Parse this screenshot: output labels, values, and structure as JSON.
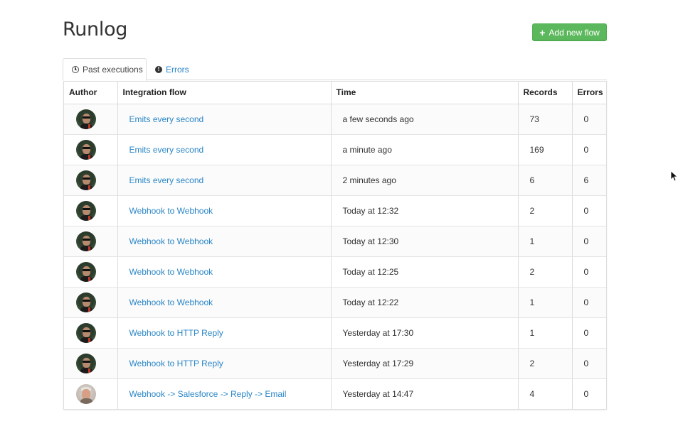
{
  "page": {
    "title": "Runlog",
    "add_button_label": "Add new flow",
    "add_button_icon": "plus-icon",
    "colors": {
      "link": "#2a86c6",
      "primary_button": "#5cb85c"
    }
  },
  "tabs": [
    {
      "label": "Past executions",
      "icon": "clock-icon",
      "active": true
    },
    {
      "label": "Errors",
      "icon": "alert-icon",
      "active": false
    }
  ],
  "table": {
    "headers": {
      "author": "Author",
      "flow": "Integration flow",
      "time": "Time",
      "records": "Records",
      "errors": "Errors"
    },
    "rows": [
      {
        "flow": "Emits every second",
        "time": "a few seconds ago",
        "records": "73",
        "errors": "0",
        "avatar": "avatar-sunglasses"
      },
      {
        "flow": "Emits every second",
        "time": "a minute ago",
        "records": "169",
        "errors": "0",
        "avatar": "avatar-sunglasses"
      },
      {
        "flow": "Emits every second",
        "time": "2 minutes ago",
        "records": "6",
        "errors": "6",
        "avatar": "avatar-sunglasses"
      },
      {
        "flow": "Webhook to Webhook",
        "time": "Today at 12:32",
        "records": "2",
        "errors": "0",
        "avatar": "avatar-sunglasses"
      },
      {
        "flow": "Webhook to Webhook",
        "time": "Today at 12:30",
        "records": "1",
        "errors": "0",
        "avatar": "avatar-sunglasses"
      },
      {
        "flow": "Webhook to Webhook",
        "time": "Today at 12:25",
        "records": "2",
        "errors": "0",
        "avatar": "avatar-sunglasses"
      },
      {
        "flow": "Webhook to Webhook",
        "time": "Today at 12:22",
        "records": "1",
        "errors": "0",
        "avatar": "avatar-sunglasses"
      },
      {
        "flow": "Webhook to HTTP Reply",
        "time": "Yesterday at 17:30",
        "records": "1",
        "errors": "0",
        "avatar": "avatar-sunglasses"
      },
      {
        "flow": "Webhook to HTTP Reply",
        "time": "Yesterday at 17:29",
        "records": "2",
        "errors": "0",
        "avatar": "avatar-sunglasses"
      },
      {
        "flow": "Webhook -> Salesforce -> Reply -> Email",
        "time": "Yesterday at 14:47",
        "records": "4",
        "errors": "0",
        "avatar": "avatar-grey-hair"
      }
    ]
  }
}
